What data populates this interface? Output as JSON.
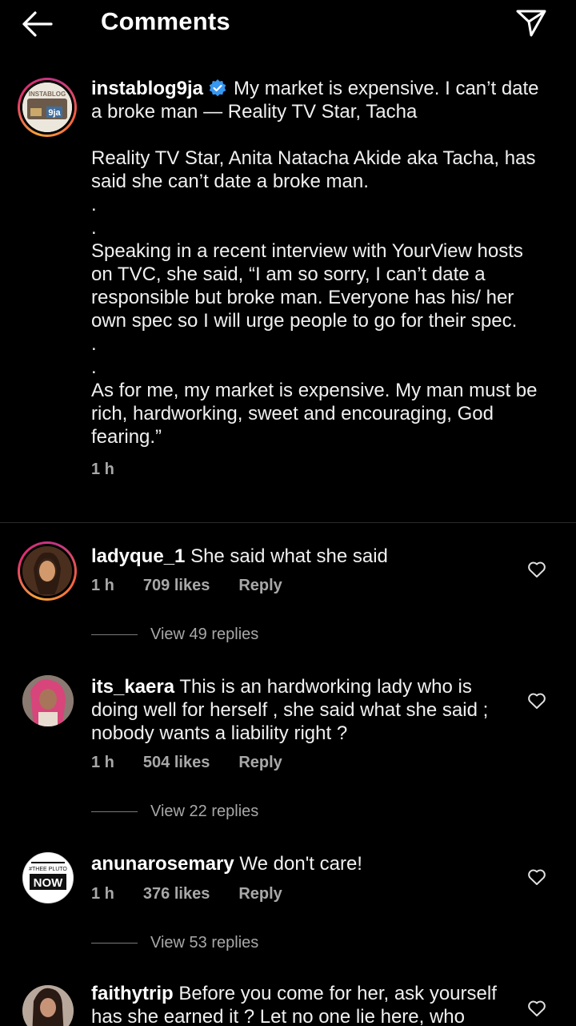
{
  "header": {
    "title": "Comments"
  },
  "caption": {
    "username": "instablog9ja",
    "avatar_text_top": "INSTABLOG",
    "avatar_text_bottom": "9ja",
    "headline": "My market is expensive. I can’t date a broke man — Reality TV Star, Tacha",
    "p1": "Reality TV Star, Anita Natacha Akide aka Tacha, has said she can’t date a broke man.",
    "dot1": ".",
    "dot2": ".",
    "p2": "Speaking in a recent interview with YourView hosts on TVC, she said, “I am so sorry, I can’t date a responsible but broke man. Everyone has his/ her own spec so I will urge people to go for their spec.",
    "dot3": ".",
    "dot4": ".",
    "p3": "As for me, my market is expensive. My man must be rich, hardworking, sweet and encouraging, God fearing.”",
    "time": "1 h"
  },
  "comments": [
    {
      "username": "ladyque_1",
      "text": "She said what she said",
      "time": "1 h",
      "likes": "709 likes",
      "reply": "Reply",
      "view_replies": "View 49 replies"
    },
    {
      "username": "its_kaera",
      "text": "This is an hardworking lady who is doing well for herself , she said what she said ; nobody wants a liability right ?",
      "time": "1 h",
      "likes": "504 likes",
      "reply": "Reply",
      "view_replies": "View 22 replies"
    },
    {
      "username": "anunarosemary",
      "text": "We don't care!",
      "time": "1 h",
      "likes": "376 likes",
      "reply": "Reply",
      "view_replies": "View 53 replies",
      "avatar_top": "#THEE PLUTO",
      "avatar_main": "NOW"
    },
    {
      "username": "faithytrip",
      "text": "Before you come for her, ask yourself has she earned it ? Let no one lie here, who"
    }
  ]
}
